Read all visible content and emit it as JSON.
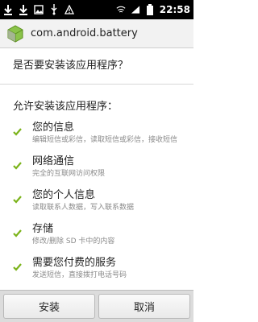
{
  "status_bar": {
    "time": "22:58",
    "left_icons": [
      "download-icon",
      "download-icon",
      "image-icon",
      "usb-icon",
      "warning-icon"
    ],
    "right_icons": [
      "wifi-icon",
      "signal-icon",
      "battery-icon"
    ]
  },
  "header": {
    "app_name": "com.android.battery",
    "icon": "android-package-icon"
  },
  "question": "是否要安装该应用程序？",
  "allow_title": "允许安装该应用程序：",
  "permissions": [
    {
      "title": "您的信息",
      "desc": "编辑短信或彩信，读取短信或彩信，接收短信"
    },
    {
      "title": "网络通信",
      "desc": "完全的互联网访问权限"
    },
    {
      "title": "您的个人信息",
      "desc": "读取联系人数据，写入联系数据"
    },
    {
      "title": "存储",
      "desc": "修改/删除 SD 卡中的内容"
    },
    {
      "title": "需要您付费的服务",
      "desc": "发送短信，直接拨打电话号码"
    }
  ],
  "buttons": {
    "install": "安装",
    "cancel": "取消"
  },
  "colors": {
    "check": "#7bb31a",
    "status_bar": "#000000"
  }
}
